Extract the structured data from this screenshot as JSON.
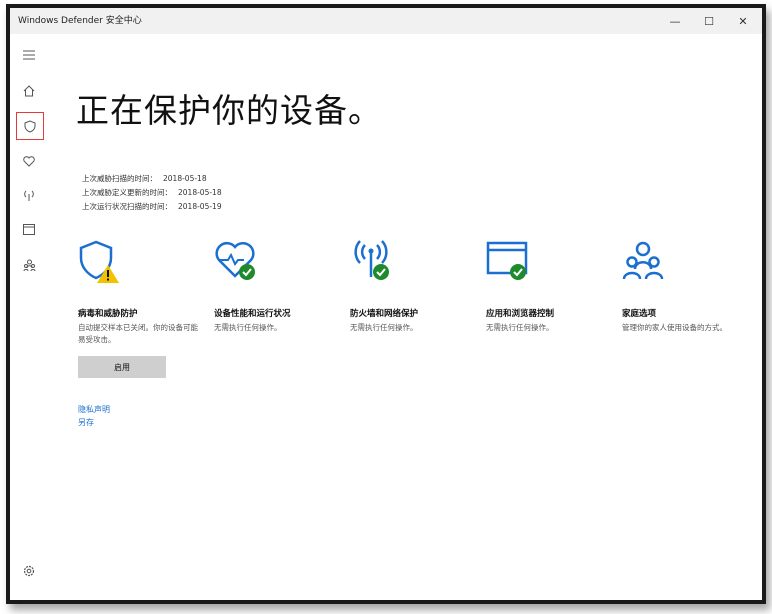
{
  "window": {
    "title": "Windows Defender 安全中心",
    "min_icon": "minimize-icon",
    "max_icon": "maximize-icon",
    "close_icon": "close-icon"
  },
  "sidebar": {
    "items": [
      {
        "icon": "hamburger-menu-icon"
      },
      {
        "icon": "home-icon"
      },
      {
        "icon": "shield-icon",
        "selected": true
      },
      {
        "icon": "heart-icon"
      },
      {
        "icon": "wifi-antenna-icon"
      },
      {
        "icon": "app-browser-icon"
      },
      {
        "icon": "family-icon"
      }
    ],
    "settings_icon": "gear-icon"
  },
  "main": {
    "title": "正在保护你的设备。",
    "scan_info": [
      {
        "label": "上次威胁扫描的时间：",
        "value": "2018-05-18"
      },
      {
        "label": "上次威胁定义更新的时间：",
        "value": "2018-05-18"
      },
      {
        "label": "上次运行状况扫描的时间：",
        "value": "2018-05-19"
      }
    ],
    "cards": [
      {
        "title": "病毒和威胁防护",
        "desc": "自动提交样本已关闭。你的设备可能易受攻击。",
        "icon": "shield-warning-icon"
      },
      {
        "title": "设备性能和运行状况",
        "desc": "无需执行任何操作。",
        "icon": "heart-check-icon"
      },
      {
        "title": "防火墙和网络保护",
        "desc": "无需执行任何操作。",
        "icon": "antenna-check-icon"
      },
      {
        "title": "应用和浏览器控制",
        "desc": "无需执行任何操作。",
        "icon": "browser-check-icon"
      },
      {
        "title": "家庭选项",
        "desc": "管理你的家人使用设备的方式。",
        "icon": "family-icon"
      }
    ],
    "enable_button": "启用",
    "links": [
      "隐私声明",
      "另存"
    ]
  },
  "colors": {
    "accent": "#1a6fd0",
    "success": "#1e8a2c",
    "warning": "#f2c200",
    "selected_outline": "#e23b3b"
  }
}
